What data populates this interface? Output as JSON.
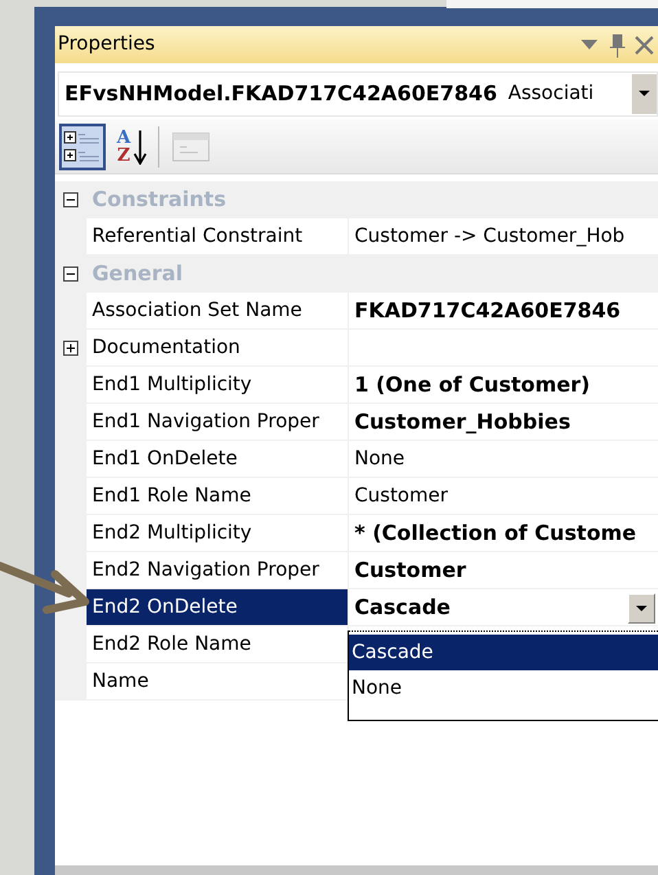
{
  "panel": {
    "title": "Properties"
  },
  "object_selector": {
    "name": "EFvsNHModel.FKAD717C42A60E7846",
    "type": "Associati"
  },
  "toolbar": [
    {
      "kind": "categorized",
      "selected": true,
      "disabled": false
    },
    {
      "kind": "alphabetical",
      "selected": false,
      "disabled": false,
      "letters": [
        "A",
        "Z"
      ]
    },
    {
      "kind": "property-pages",
      "selected": false,
      "disabled": true
    }
  ],
  "categories": [
    {
      "label": "Constraints",
      "expanded": true,
      "properties": [
        {
          "name": "Referential Constraint",
          "value": "Customer -> Customer_Hob",
          "bold": false,
          "selected": false
        }
      ]
    },
    {
      "label": "General",
      "expanded": true,
      "properties": [
        {
          "name": "Association Set Name",
          "value": "FKAD717C42A60E7846",
          "bold": true,
          "selected": false
        },
        {
          "name": "Documentation",
          "expanded": false,
          "selected": false
        },
        {
          "name": "End1 Multiplicity",
          "value": "1 (One of Customer)",
          "bold": true,
          "selected": false
        },
        {
          "name": "End1 Navigation Proper",
          "value": "Customer_Hobbies",
          "bold": true,
          "selected": false
        },
        {
          "name": "End1 OnDelete",
          "value": "None",
          "bold": false,
          "selected": false
        },
        {
          "name": "End1 Role Name",
          "value": "Customer",
          "bold": false,
          "selected": false
        },
        {
          "name": "End2 Multiplicity",
          "value": "* (Collection of Custome",
          "bold": true,
          "selected": false
        },
        {
          "name": "End2 Navigation Proper",
          "value": "Customer",
          "bold": true,
          "selected": false
        },
        {
          "name": "End2 OnDelete",
          "value": "Cascade",
          "bold": true,
          "selected": true,
          "dropdown": {
            "open": true,
            "options": [
              {
                "label": "Cascade",
                "selected": true
              },
              {
                "label": "None",
                "selected": false
              }
            ]
          }
        },
        {
          "name": "End2 Role Name",
          "selected": false
        },
        {
          "name": "Name",
          "selected": false
        }
      ]
    }
  ]
}
